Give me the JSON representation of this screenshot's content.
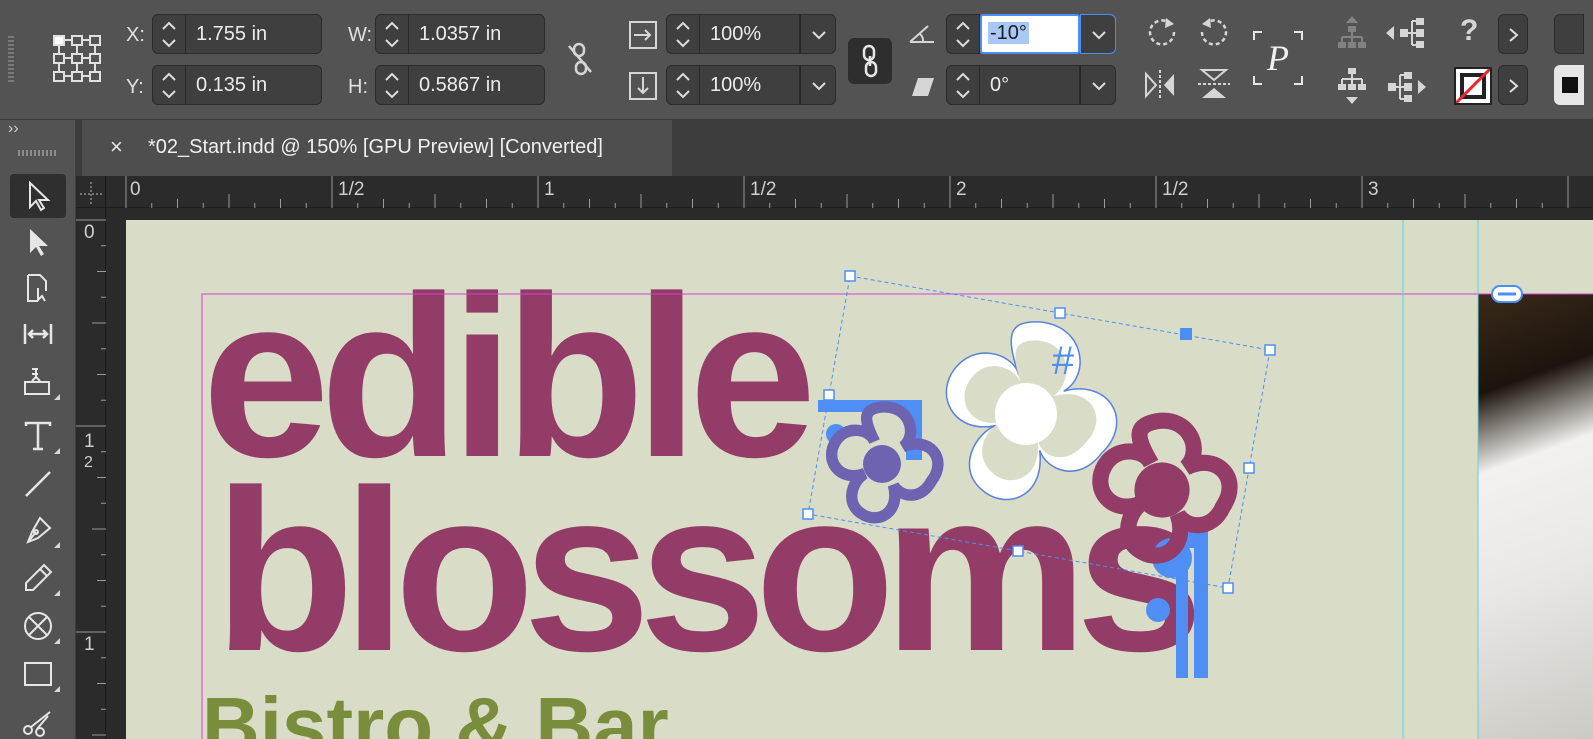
{
  "control_panel": {
    "x_label": "X:",
    "x_value": "1.755 in",
    "y_label": "Y:",
    "y_value": "0.135 in",
    "w_label": "W:",
    "w_value": "1.0357 in",
    "h_label": "H:",
    "h_value": "0.5867 in",
    "scale_x_value": "100%",
    "scale_y_value": "100%",
    "rotation_value": "-10°",
    "shear_value": "0°",
    "help_label": "?"
  },
  "document_tab": {
    "close_label": "×",
    "title": "*02_Start.indd @ 150% [GPU Preview] [Converted]"
  },
  "tools_panel": {
    "collapse_label": "››"
  },
  "ruler": {
    "horizontal": [
      "0",
      "1/2",
      "1",
      "1/2",
      "2",
      "1/2",
      "3"
    ],
    "vertical": [
      "0",
      "1",
      "2",
      "1"
    ]
  },
  "canvas": {
    "title_line1": "edible",
    "title_line2": "blossoms",
    "subtitle_partial": "Bistro & Bar"
  },
  "colors": {
    "brand_plum": "#933c68",
    "brand_olive": "#7a8d3c",
    "page_bg": "#d9ddc8",
    "selection_blue": "#4a8ff5",
    "flower_violet": "#6e63b0"
  }
}
